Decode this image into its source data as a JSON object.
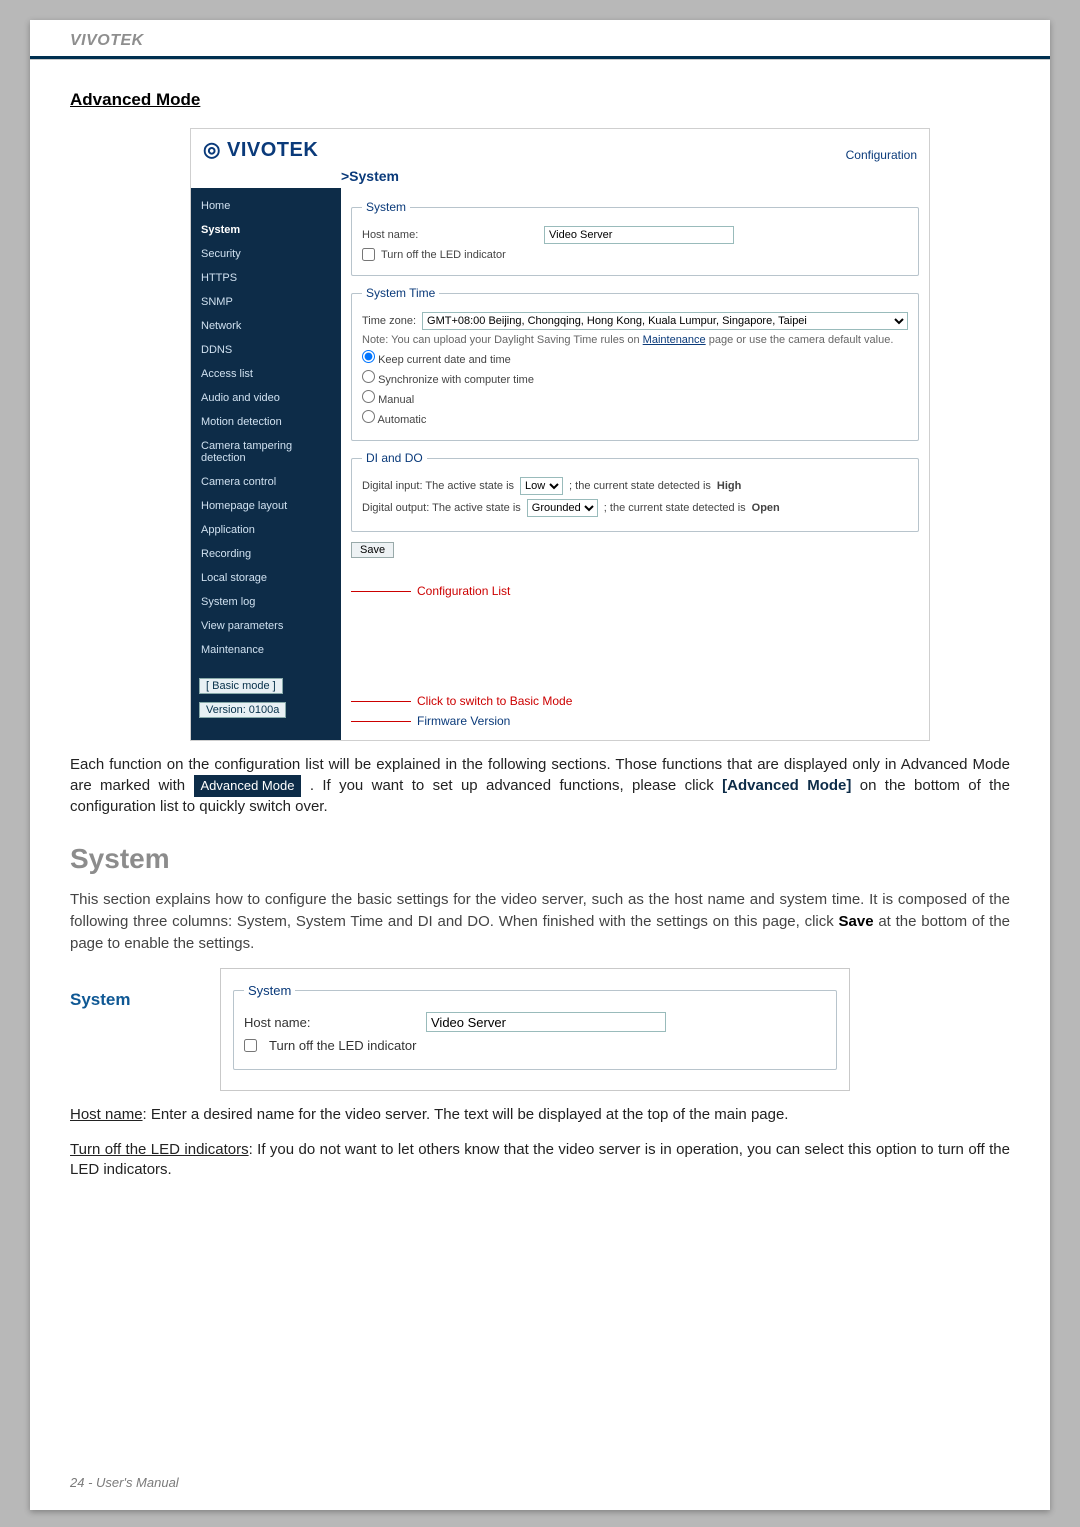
{
  "header": {
    "brand": "VIVOTEK"
  },
  "sectionTitle": "Advanced Mode",
  "screenshot": {
    "logo": "VIVOTEK",
    "confLink": "Configuration",
    "pageTitle": ">System",
    "nav": {
      "items": [
        "Home",
        "System",
        "Security",
        "HTTPS",
        "SNMP",
        "Network",
        "DDNS",
        "Access list",
        "Audio and video",
        "Motion detection",
        "Camera tampering detection",
        "Camera control",
        "Homepage layout",
        "Application",
        "Recording",
        "Local storage",
        "System log",
        "View parameters",
        "Maintenance"
      ],
      "basicMode": "[ Basic mode ]",
      "version": "Version: 0100a"
    },
    "system": {
      "legend": "System",
      "hostLabel": "Host name:",
      "hostValue": "Video Server",
      "ledLabel": "Turn off the LED indicator"
    },
    "time": {
      "legend": "System Time",
      "tzLabel": "Time zone:",
      "tzValue": "GMT+08:00 Beijing, Chongqing, Hong Kong, Kuala Lumpur, Singapore, Taipei",
      "note1": "Note: You can upload your Daylight Saving Time rules on ",
      "noteLink": "Maintenance",
      "note2": " page or use the camera default value.",
      "opt1": "Keep current date and time",
      "opt2": "Synchronize with computer time",
      "opt3": "Manual",
      "opt4": "Automatic"
    },
    "dido": {
      "legend": "DI and DO",
      "di1": "Digital input: The active state is ",
      "diSel": "Low",
      "di2": " ; the current state detected is ",
      "diState": "High",
      "do1": "Digital output: The active state is ",
      "doSel": "Grounded",
      "do2": " ; the current state detected is ",
      "doState": "Open"
    },
    "save": "Save",
    "annot": {
      "confList": "Configuration List",
      "basic": "Click to switch to Basic Mode",
      "fw": "Firmware Version"
    }
  },
  "para1a": "Each function on the configuration list will be explained in the following sections. Those functions that are displayed only in Advanced Mode are marked with ",
  "para1tag": "Advanced Mode",
  "para1b": ". If you want to set up advanced functions, please click ",
  "para1bold": "[Advanced Mode]",
  "para1c": " on the bottom of the configuration list to quickly switch over.",
  "h2": "System",
  "body1a": "This section explains how to configure the basic settings for the video server, such as the host name and system time. It is composed of the following three columns: System, System Time and DI and DO. When finished with the settings on this page, click ",
  "body1save": "Save",
  "body1b": " at the bottom of the page to enable the settings.",
  "subH": "System",
  "mini": {
    "legend": "System",
    "hostLabel": "Host name:",
    "hostValue": "Video Server",
    "ledLabel": "Turn off the LED indicator"
  },
  "def1term": "Host name",
  "def1text": ": Enter a desired name for the video server. The text will be displayed at the top of the main page.",
  "def2term": "Turn off the LED indicators",
  "def2text": ": If you do not want to let others know that the video server is in operation, you can select this option to turn off the LED indicators.",
  "footer": "24 - User's Manual"
}
